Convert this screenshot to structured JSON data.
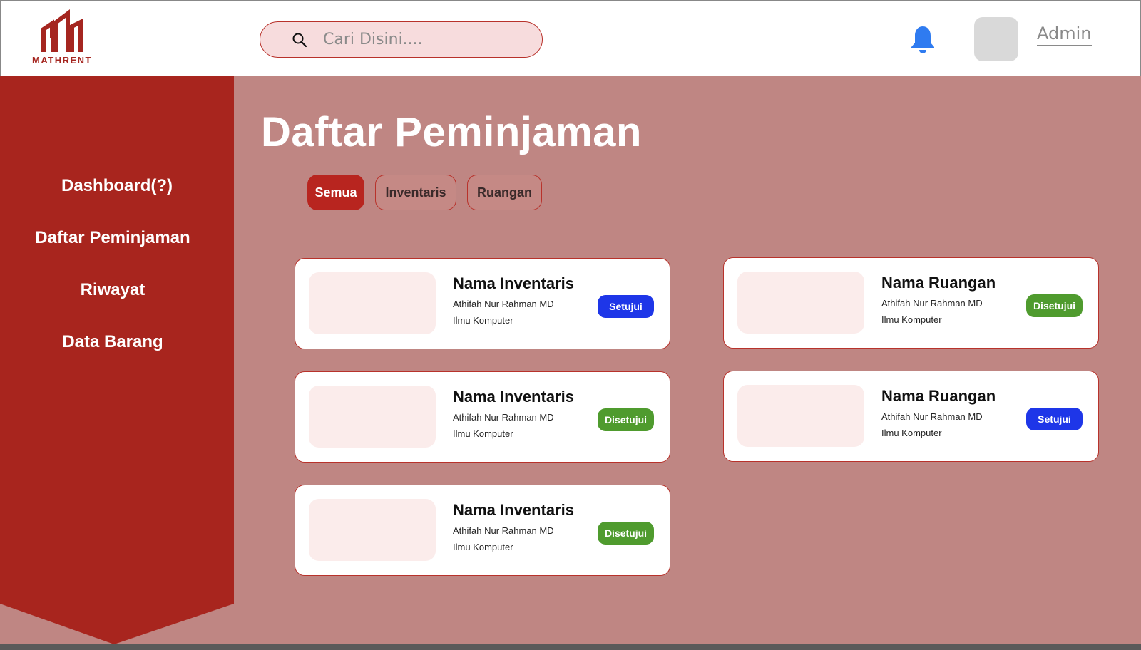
{
  "brand": {
    "name": "MATHRENT",
    "color": "#a52620"
  },
  "search": {
    "placeholder": "Cari Disini...."
  },
  "header": {
    "user_label": "Admin",
    "bell_color": "#2f7bf0"
  },
  "sidebar": {
    "items": [
      {
        "label": "Dashboard(?)"
      },
      {
        "label": "Daftar Peminjaman"
      },
      {
        "label": "Riwayat"
      },
      {
        "label": "Data Barang"
      }
    ]
  },
  "main": {
    "title": "Daftar Peminjaman",
    "filters": [
      {
        "label": "Semua",
        "active": true
      },
      {
        "label": "Inventaris",
        "active": false
      },
      {
        "label": "Ruangan",
        "active": false
      }
    ],
    "cards": [
      {
        "title": "Nama Inventaris",
        "name": "Athifah Nur Rahman MD",
        "dept": "Ilmu Komputer",
        "status": "Setujui"
      },
      {
        "title": "Nama Ruangan",
        "name": "Athifah Nur Rahman MD",
        "dept": "Ilmu Komputer",
        "status": "Disetujui"
      },
      {
        "title": "Nama Inventaris",
        "name": "Athifah Nur Rahman MD",
        "dept": "Ilmu Komputer",
        "status": "Disetujui"
      },
      {
        "title": "Nama Ruangan",
        "name": "Athifah Nur Rahman MD",
        "dept": "Ilmu Komputer",
        "status": "Setujui"
      },
      {
        "title": "Nama Inventaris",
        "name": "Athifah Nur Rahman MD",
        "dept": "Ilmu Komputer",
        "status": "Disetujui"
      }
    ]
  },
  "colors": {
    "sidebar": "#a8251e",
    "background": "#bf8683",
    "setujui": "#1e36e8",
    "disetujui": "#4f9b2e"
  }
}
